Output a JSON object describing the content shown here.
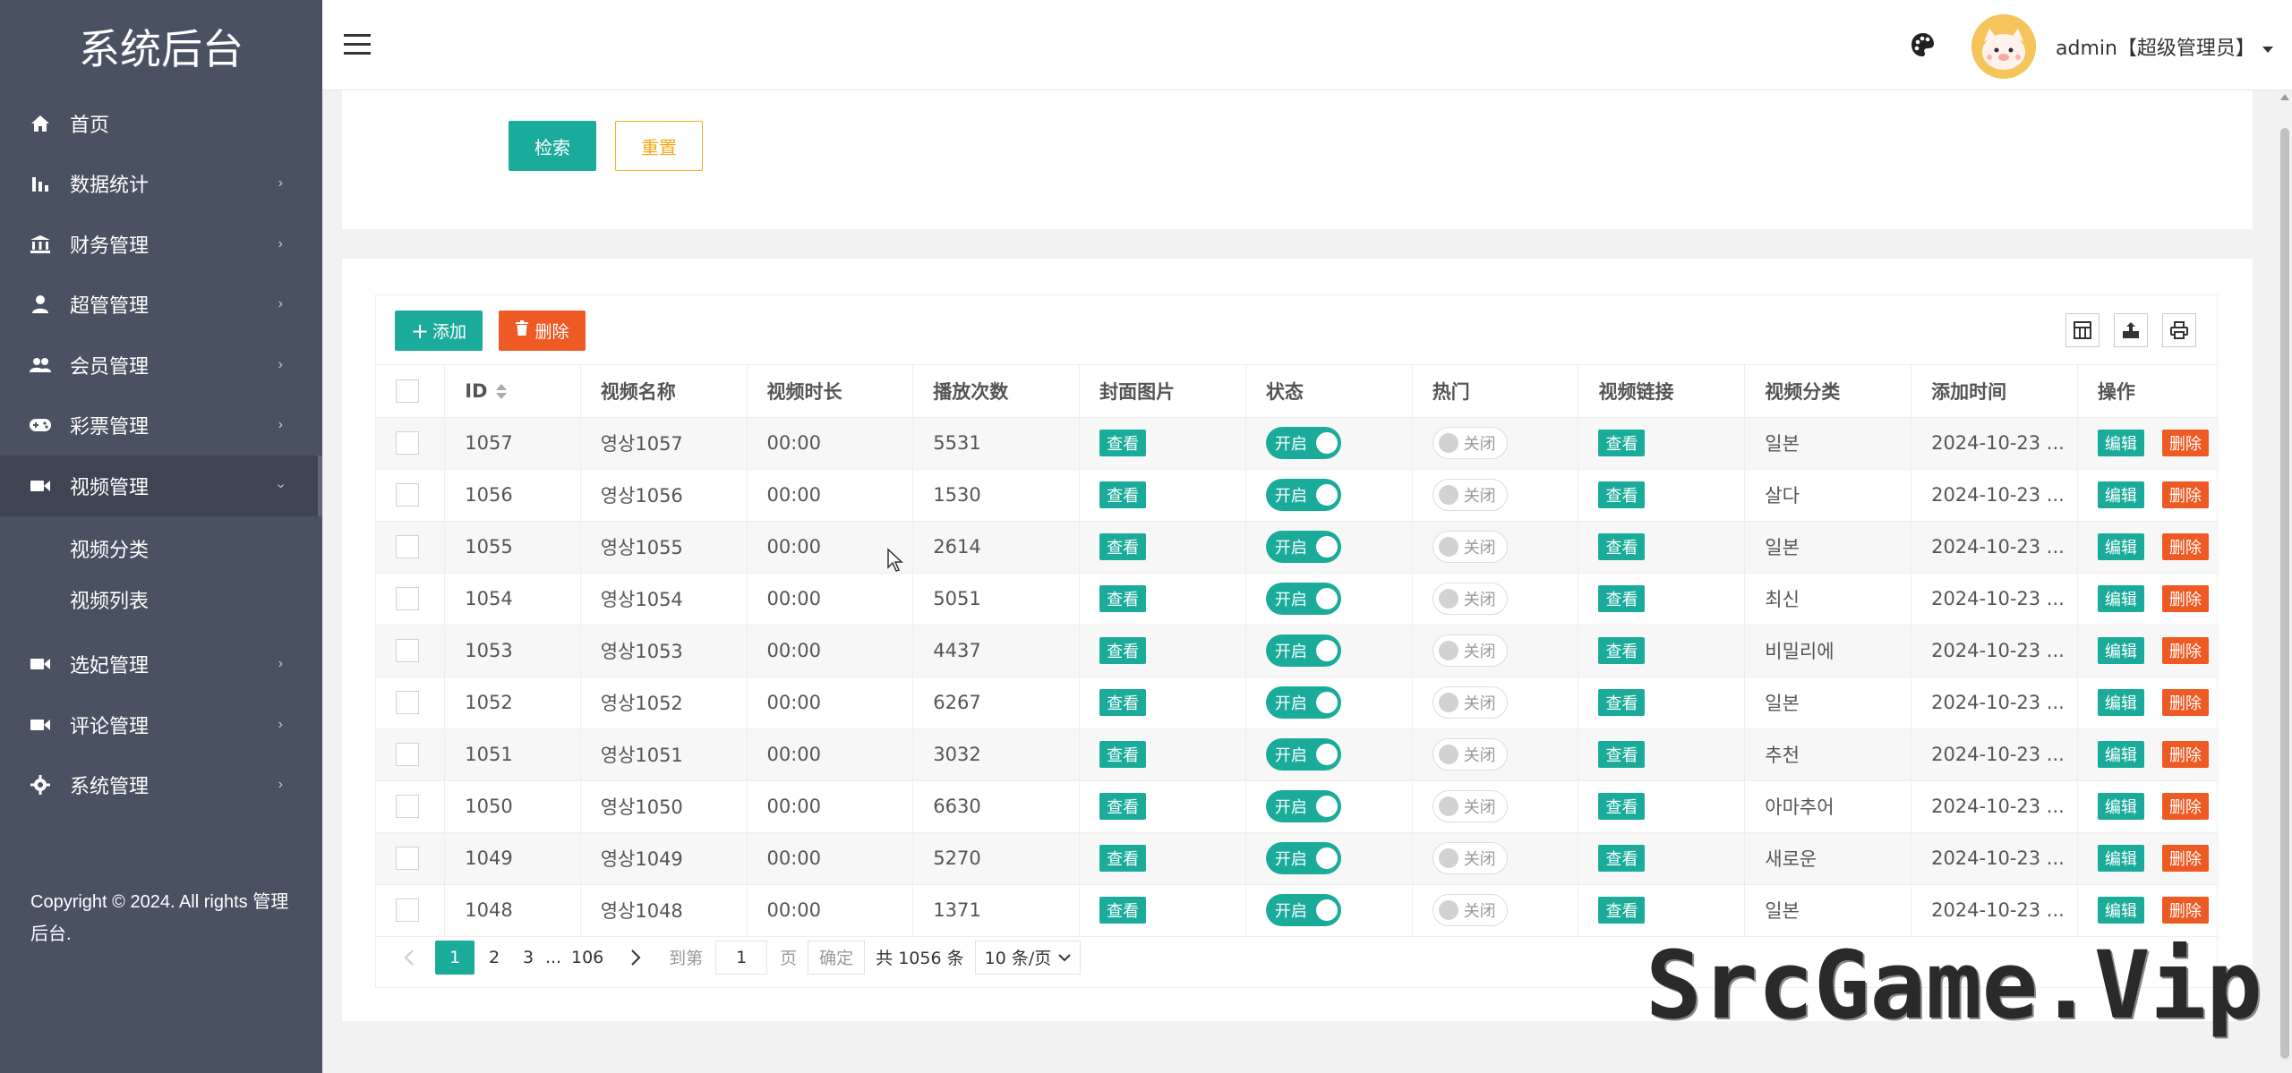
{
  "sidebar": {
    "logo": "系统后台",
    "items": [
      {
        "label": "首页",
        "icon": "home-icon",
        "arrow": ""
      },
      {
        "label": "数据统计",
        "icon": "bar-chart-icon",
        "arrow": "›"
      },
      {
        "label": "财务管理",
        "icon": "bank-icon",
        "arrow": "›"
      },
      {
        "label": "超管管理",
        "icon": "user-icon",
        "arrow": "›"
      },
      {
        "label": "会员管理",
        "icon": "users-icon",
        "arrow": "›"
      },
      {
        "label": "彩票管理",
        "icon": "gamepad-icon",
        "arrow": "›"
      },
      {
        "label": "视频管理",
        "icon": "video-camera-icon",
        "arrow": "›"
      },
      {
        "label": "选妃管理",
        "icon": "video-camera-icon",
        "arrow": "›"
      },
      {
        "label": "评论管理",
        "icon": "video-camera-icon",
        "arrow": "›"
      },
      {
        "label": "系统管理",
        "icon": "gear-icon",
        "arrow": "›"
      }
    ],
    "subitems": [
      "视频分类",
      "视频列表"
    ],
    "copyright": "Copyright © 2024. All rights 管理后台."
  },
  "header": {
    "user": "admin【超级管理员】"
  },
  "search": {
    "search_label": "检索",
    "reset_label": "重置"
  },
  "toolbar": {
    "add_label": "添加",
    "delete_label": "删除"
  },
  "table": {
    "headers": [
      "ID",
      "视频名称",
      "视频时长",
      "播放次数",
      "封面图片",
      "状态",
      "热门",
      "视频链接",
      "视频分类",
      "添加时间",
      "操作"
    ],
    "view_label": "查看",
    "on_label": "开启",
    "off_label": "关闭",
    "edit_label": "编辑",
    "delete_label": "删除",
    "rows": [
      {
        "id": "1057",
        "name": "영상1057",
        "duration": "00:00",
        "plays": "5531",
        "category": "일본",
        "time": "2024-10-23 ..."
      },
      {
        "id": "1056",
        "name": "영상1056",
        "duration": "00:00",
        "plays": "1530",
        "category": "살다",
        "time": "2024-10-23 ..."
      },
      {
        "id": "1055",
        "name": "영상1055",
        "duration": "00:00",
        "plays": "2614",
        "category": "일본",
        "time": "2024-10-23 ..."
      },
      {
        "id": "1054",
        "name": "영상1054",
        "duration": "00:00",
        "plays": "5051",
        "category": "최신",
        "time": "2024-10-23 ..."
      },
      {
        "id": "1053",
        "name": "영상1053",
        "duration": "00:00",
        "plays": "4437",
        "category": "비밀리에",
        "time": "2024-10-23 ..."
      },
      {
        "id": "1052",
        "name": "영상1052",
        "duration": "00:00",
        "plays": "6267",
        "category": "일본",
        "time": "2024-10-23 ..."
      },
      {
        "id": "1051",
        "name": "영상1051",
        "duration": "00:00",
        "plays": "3032",
        "category": "추천",
        "time": "2024-10-23 ..."
      },
      {
        "id": "1050",
        "name": "영상1050",
        "duration": "00:00",
        "plays": "6630",
        "category": "아마추어",
        "time": "2024-10-23 ..."
      },
      {
        "id": "1049",
        "name": "영상1049",
        "duration": "00:00",
        "plays": "5270",
        "category": "새로운",
        "time": "2024-10-23 ..."
      },
      {
        "id": "1048",
        "name": "영상1048",
        "duration": "00:00",
        "plays": "1371",
        "category": "일본",
        "time": "2024-10-23 ..."
      }
    ]
  },
  "pagination": {
    "pages": [
      "1",
      "2",
      "3",
      "...",
      "106"
    ],
    "goto_label": "到第",
    "goto_value": "1",
    "page_unit": "页",
    "confirm_label": "确定",
    "total": "共 1056 条",
    "page_size": "10 条/页"
  },
  "watermark": "SrcGame.Vip",
  "colors": {
    "sidebar_bg": "#4a5162",
    "accent": "#1aab9b",
    "danger": "#ee5a24",
    "warning": "#f0b21f"
  }
}
